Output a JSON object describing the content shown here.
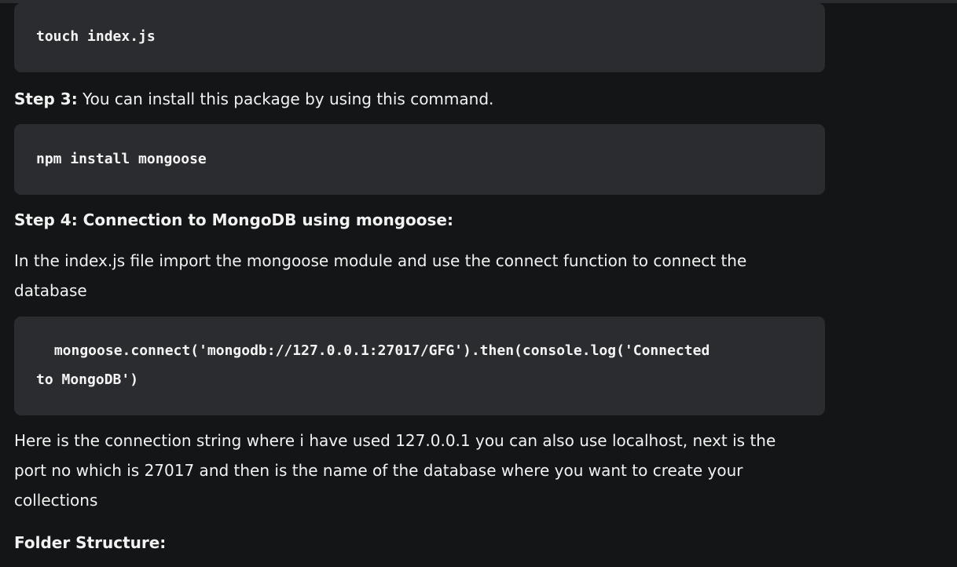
{
  "article": {
    "code_touch": "touch index.js",
    "step3_label": "Step 3:",
    "step3_text": " You can install this package by using this command.",
    "code_install": "npm install mongoose",
    "step4_heading": "Step 4: Connection to MongoDB using mongoose:",
    "step4_intro_line1": "In the index.js file import the mongoose module and use the connect function to connect the",
    "step4_intro_line2": "database",
    "code_connect_line1": " mongoose.connect('mongodb://127.0.0.1:27017/GFG').then(console.log('Connected",
    "code_connect_line2": "to MongoDB')",
    "explanation_line1": "Here is the connection string where i have used 127.0.0.1 you can also use localhost, next is the",
    "explanation_line2": "port no which is 27017 and then is the name of the database where you want to create your",
    "explanation_line3": "collections",
    "folder_structure_heading": "Folder Structure:"
  }
}
